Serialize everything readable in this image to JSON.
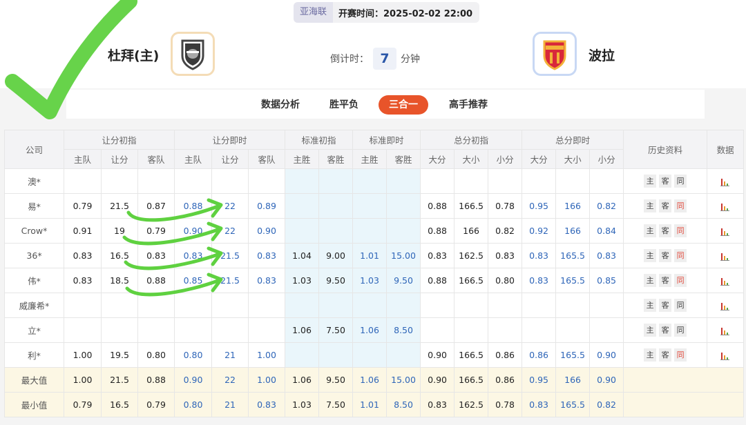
{
  "match": {
    "league": "亚海联",
    "start_time": "开赛时间：2025-02-02 22:00",
    "home_name": "杜拜(主)",
    "away_name": "波拉",
    "home_logo_icon": "dubai-club-crest-icon",
    "away_logo_icon": "bola-club-crest-icon",
    "countdown_label": "倒计时：",
    "countdown_value": "7",
    "countdown_unit": "分钟"
  },
  "tabs": [
    {
      "label": "数据分析",
      "active": false
    },
    {
      "label": "胜平负",
      "active": false
    },
    {
      "label": "三合一",
      "active": true
    },
    {
      "label": "高手推荐",
      "active": false
    }
  ],
  "table": {
    "company_header": "公司",
    "group_headers": [
      "让分初指",
      "让分即时",
      "标准初指",
      "标准即时",
      "总分初指",
      "总分即时"
    ],
    "history_header": "历史资料",
    "data_header": "数据",
    "sub_headers": [
      "主队",
      "让分",
      "客队",
      "主队",
      "让分",
      "客队",
      "主胜",
      "客胜",
      "主胜",
      "客胜",
      "大分",
      "大小",
      "小分",
      "大分",
      "大小",
      "小分"
    ],
    "history_buttons": [
      "主",
      "客",
      "同"
    ],
    "rows": [
      {
        "company": "澳*",
        "cells": [
          "",
          "",
          "",
          "",
          "",
          "",
          "",
          "",
          "",
          "",
          "",
          "",
          "",
          "",
          "",
          ""
        ],
        "same_red": false
      },
      {
        "company": "易*",
        "cells": [
          "0.79",
          "21.5",
          "0.87",
          "0.88",
          "22",
          "0.89",
          "",
          "",
          "",
          "",
          "0.88",
          "166.5",
          "0.78",
          "0.95",
          "166",
          "0.82"
        ],
        "same_red": true
      },
      {
        "company": "Crow*",
        "cells": [
          "0.91",
          "19",
          "0.79",
          "0.90",
          "22",
          "0.90",
          "",
          "",
          "",
          "",
          "0.88",
          "166",
          "0.82",
          "0.92",
          "166",
          "0.84"
        ],
        "same_red": true
      },
      {
        "company": "36*",
        "cells": [
          "0.83",
          "16.5",
          "0.83",
          "0.83",
          "21.5",
          "0.83",
          "1.04",
          "9.00",
          "1.01",
          "15.00",
          "0.83",
          "162.5",
          "0.83",
          "0.83",
          "165.5",
          "0.83"
        ],
        "same_red": true
      },
      {
        "company": "伟*",
        "cells": [
          "0.83",
          "18.5",
          "0.88",
          "0.85",
          "21.5",
          "0.83",
          "1.03",
          "9.50",
          "1.03",
          "9.50",
          "0.88",
          "166.5",
          "0.80",
          "0.83",
          "165.5",
          "0.85"
        ],
        "same_red": true
      },
      {
        "company": "威廉希*",
        "cells": [
          "",
          "",
          "",
          "",
          "",
          "",
          "",
          "",
          "",
          "",
          "",
          "",
          "",
          "",
          "",
          ""
        ],
        "same_red": false
      },
      {
        "company": "立*",
        "cells": [
          "",
          "",
          "",
          "",
          "",
          "",
          "1.06",
          "7.50",
          "1.06",
          "8.50",
          "",
          "",
          "",
          "",
          "",
          ""
        ],
        "same_red": false
      },
      {
        "company": "利*",
        "cells": [
          "1.00",
          "19.5",
          "0.80",
          "0.80",
          "21",
          "1.00",
          "",
          "",
          "",
          "",
          "0.90",
          "166.5",
          "0.86",
          "0.86",
          "165.5",
          "0.90"
        ],
        "same_red": true
      }
    ],
    "summary": [
      {
        "label": "最大值",
        "cells": [
          "1.00",
          "21.5",
          "0.88",
          "0.90",
          "22",
          "1.00",
          "1.06",
          "9.50",
          "1.06",
          "15.00",
          "0.90",
          "166.5",
          "0.86",
          "0.95",
          "166",
          "0.90"
        ]
      },
      {
        "label": "最小值",
        "cells": [
          "0.79",
          "16.5",
          "0.79",
          "0.80",
          "21",
          "0.83",
          "1.03",
          "7.50",
          "1.01",
          "8.50",
          "0.83",
          "162.5",
          "0.78",
          "0.83",
          "165.5",
          "0.82"
        ]
      }
    ],
    "colors": {
      "live_values": "#2e65b8",
      "active_tab": "#e8542a",
      "highlight": "#eaf6fb",
      "summary_bg": "#fcf7e4",
      "annotation": "#5fd140"
    }
  }
}
